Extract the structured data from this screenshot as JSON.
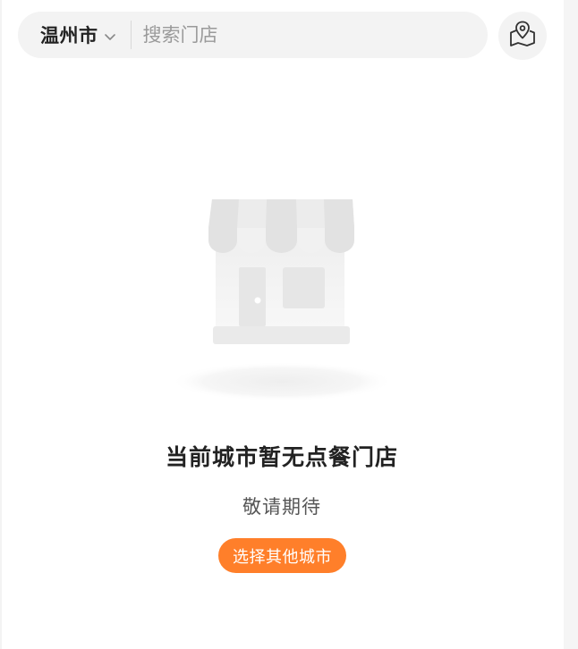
{
  "header": {
    "city": "温州市",
    "search_placeholder": "搜索门店"
  },
  "empty_state": {
    "title": "当前城市暂无点餐门店",
    "subtitle": "敬请期待",
    "button_label": "选择其他城市"
  },
  "icons": {
    "city_dropdown": "chevron-down-icon",
    "map": "map-location-icon",
    "illustration": "store-icon"
  },
  "colors": {
    "accent": "#ff7f2a",
    "search_bg": "#f3f3f3"
  }
}
